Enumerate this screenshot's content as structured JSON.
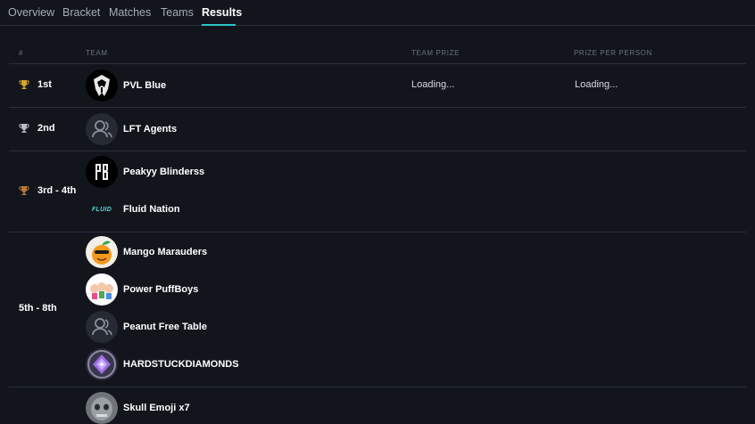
{
  "tabs": [
    {
      "label": "Overview",
      "active": false
    },
    {
      "label": "Bracket",
      "active": false
    },
    {
      "label": "Matches",
      "active": false
    },
    {
      "label": "Teams",
      "active": false
    },
    {
      "label": "Results",
      "active": true
    }
  ],
  "accent_color": "#2ec4c6",
  "table": {
    "headers": {
      "rank": "#",
      "team": "TEAM",
      "team_prize": "TEAM PRIZE",
      "prize_per_person": "PRIZE PER PERSON"
    },
    "groups": [
      {
        "rank": "1st",
        "trophy": "gold",
        "team_prize": "Loading...",
        "prize_per_person": "Loading...",
        "teams": [
          {
            "name": "PVL Blue",
            "avatar": "pvl-blue-logo"
          }
        ]
      },
      {
        "rank": "2nd",
        "trophy": "silver",
        "teams": [
          {
            "name": "LFT Agents",
            "avatar": "default-user-icon"
          }
        ]
      },
      {
        "rank": "3rd - 4th",
        "trophy": "bronze",
        "teams": [
          {
            "name": "Peakyy Blinderss",
            "avatar": "peakyy-blinderss-logo"
          },
          {
            "name": "Fluid Nation",
            "avatar": "fluid-nation-logo",
            "logo_text": "FLUID"
          }
        ]
      },
      {
        "rank": "5th - 8th",
        "trophy": "none",
        "teams": [
          {
            "name": "Mango Marauders",
            "avatar": "mango-logo"
          },
          {
            "name": "Power PuffBoys",
            "avatar": "powerpuff-logo"
          },
          {
            "name": "Peanut Free Table",
            "avatar": "default-user-icon"
          },
          {
            "name": "HARDSTUCKDIAMONDS",
            "avatar": "diamond-logo"
          }
        ]
      },
      {
        "rank": "",
        "trophy": "none",
        "teams": [
          {
            "name": "Skull Emoji x7",
            "avatar": "skull-photo-logo"
          }
        ]
      }
    ]
  }
}
